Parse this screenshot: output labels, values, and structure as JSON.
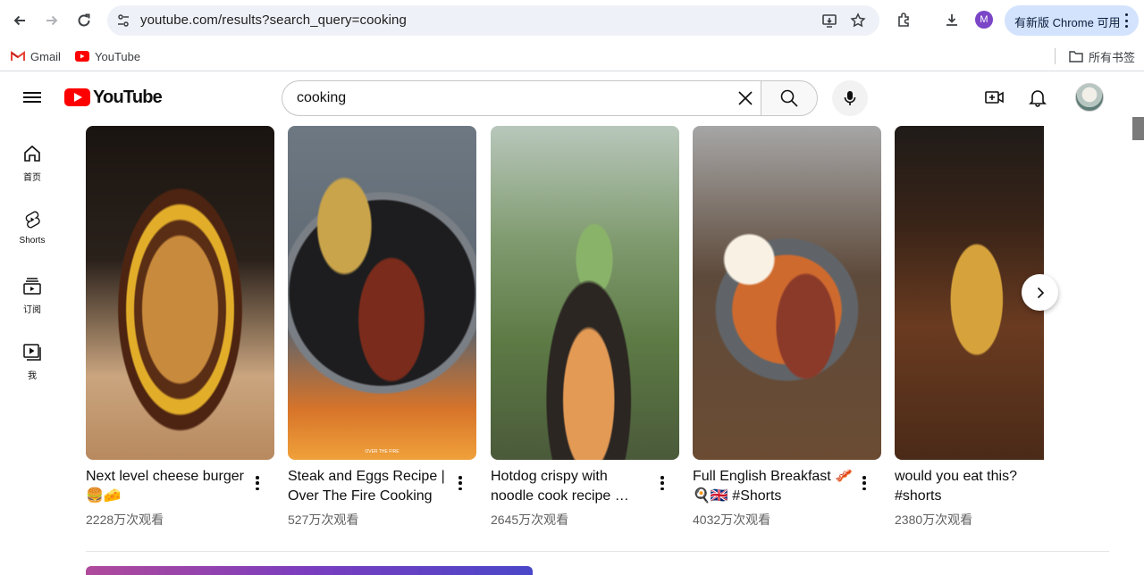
{
  "browser": {
    "url": "youtube.com/results?search_query=cooking",
    "profile_initial": "M",
    "update_label": "有新版 Chrome 可用",
    "bookmarks": [
      {
        "label": "Gmail"
      },
      {
        "label": "YouTube"
      }
    ],
    "all_bookmarks_label": "所有书签"
  },
  "youtube": {
    "logo_text": "YouTube",
    "search_query": "cooking",
    "rail": [
      {
        "label": "首页",
        "icon": "home-icon"
      },
      {
        "label": "Shorts",
        "icon": "shorts-icon"
      },
      {
        "label": "订阅",
        "icon": "subscriptions-icon"
      },
      {
        "label": "我",
        "icon": "you-icon"
      }
    ],
    "shorts": [
      {
        "title": "Next level cheese burger 🍔🧀",
        "views": "2228万次观看"
      },
      {
        "title": "Steak and Eggs Recipe | Over The Fire Cooking …",
        "views": "527万次观看",
        "thumb_text": "OVER THE FIRE"
      },
      {
        "title": "Hotdog crispy with noodle cook recipe …",
        "views": "2645万次观看"
      },
      {
        "title": "Full English Breakfast 🥓🍳🇬🇧 #Shorts",
        "views": "4032万次观看"
      },
      {
        "title": "would you eat this? #shorts",
        "views": "2380万次观看"
      }
    ]
  },
  "colors": {
    "yt_red": "#ff0000",
    "update_pill": "#d3e3fd",
    "profile": "#7b45c7"
  }
}
